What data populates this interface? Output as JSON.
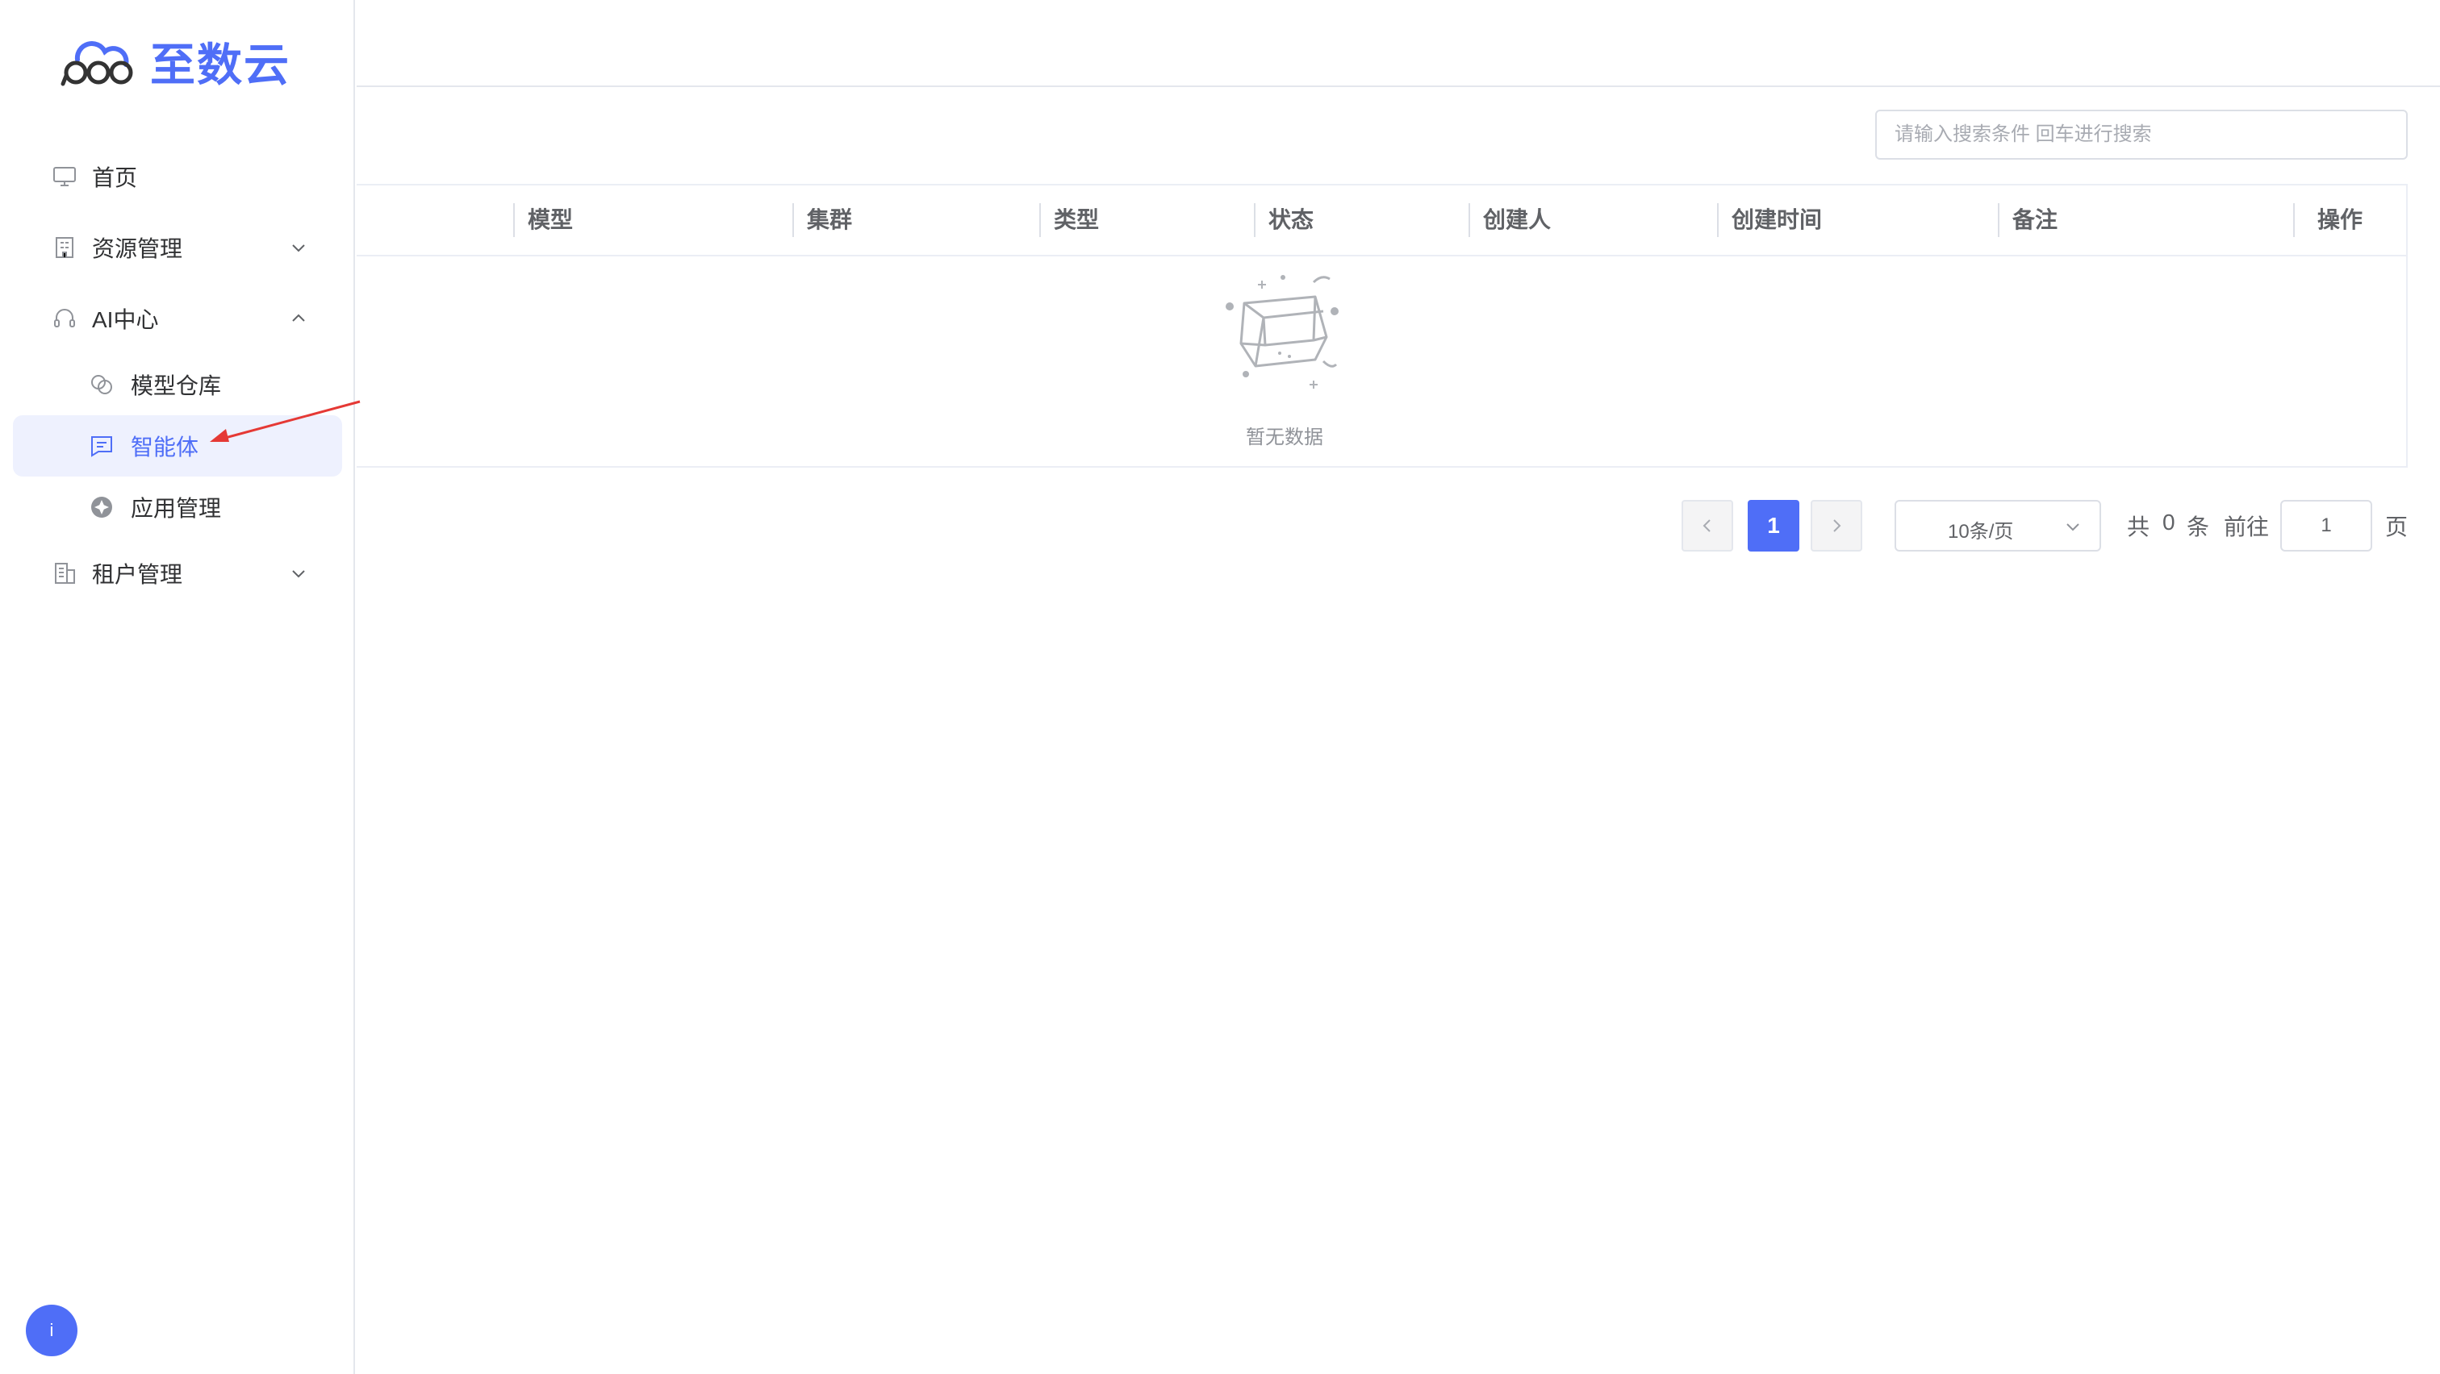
{
  "brand": {
    "name": "至数云",
    "color": "#4f6ef7"
  },
  "sidebar": {
    "items": [
      {
        "label": "首页",
        "icon": "monitor-icon"
      },
      {
        "label": "资源管理",
        "icon": "building-icon",
        "expanded": false
      },
      {
        "label": "AI中心",
        "icon": "headset-icon",
        "expanded": true
      },
      {
        "label": "模型仓库",
        "icon": "overlap-circles-icon"
      },
      {
        "label": "智能体",
        "icon": "chat-icon",
        "active": true
      },
      {
        "label": "应用管理",
        "icon": "app-icon"
      },
      {
        "label": "租户管理",
        "icon": "office-icon",
        "expanded": false
      }
    ]
  },
  "search": {
    "placeholder": "请输入搜索条件 回车进行搜索"
  },
  "table": {
    "columns": [
      "模型",
      "集群",
      "类型",
      "状态",
      "创建人",
      "创建时间",
      "备注",
      "操作"
    ],
    "rows": [],
    "empty_text": "暂无数据"
  },
  "pagination": {
    "current_page": "1",
    "page_size": "10条/页",
    "total_prefix": "共",
    "total": "0",
    "total_suffix": "条",
    "goto_label": "前往",
    "goto_value": "1",
    "page_suffix": "页"
  },
  "user": {
    "avatar_text": "i"
  },
  "colors": {
    "accent": "#4f6ef7",
    "active_bg": "#eef1fe",
    "annotation_arrow": "#e53935"
  }
}
